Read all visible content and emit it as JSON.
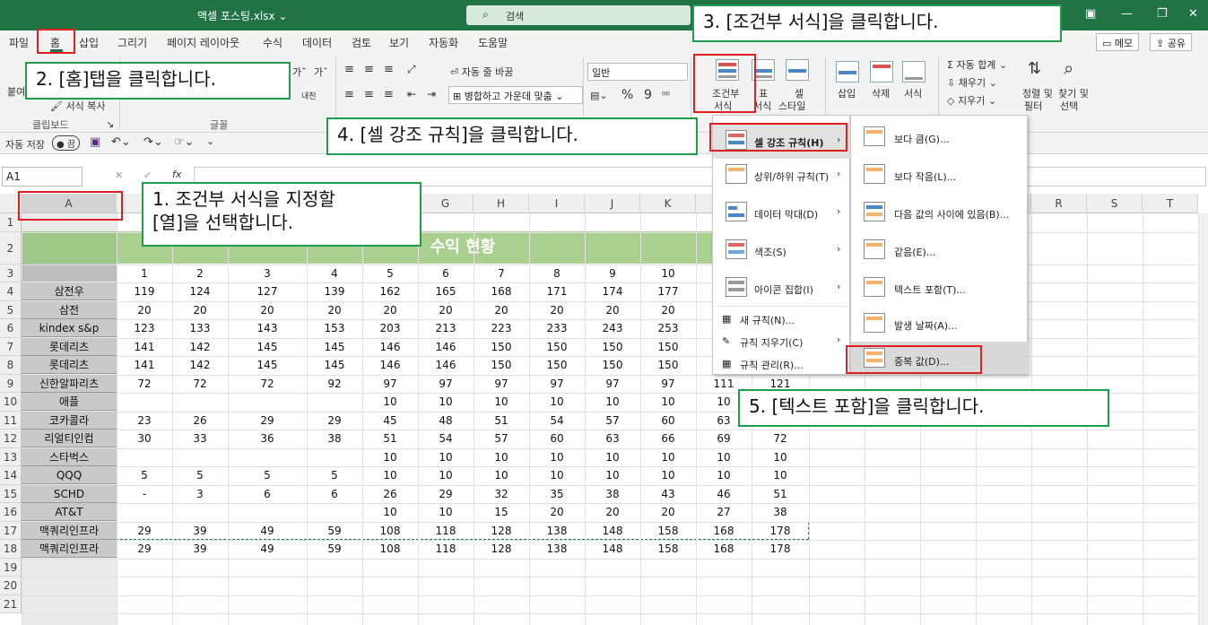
{
  "window": {
    "title": "액셀 포스팅.xlsx ⌄",
    "search_placeholder": "검색"
  },
  "menu_tabs": [
    "파일",
    "홈",
    "삽입",
    "그리기",
    "페이지 레이아웃",
    "수식",
    "데이터",
    "검토",
    "보기",
    "자동화",
    "도움말"
  ],
  "top_right": {
    "memo": "메모",
    "share": "공유"
  },
  "ribbon": {
    "paste": "붙여",
    "format_painter": "서식 복사",
    "clipboard": "클립보드",
    "font_group": "글꼴",
    "font_size_up": "가ˆ",
    "font_size_down": "가ˇ",
    "phonetic": "내천",
    "wrap_text": "자동 줄 바꿈",
    "merge_center": "병합하고 가운데 맞춤",
    "number_format": "일반",
    "percent": "%",
    "comma": "9",
    "cond_format_l1": "조건부",
    "cond_format_l2": "서식",
    "table_l1": "표",
    "table_l2": "서식",
    "cell_style_l1": "셀",
    "cell_style_l2": "스타일",
    "insert": "삽입",
    "delete": "삭제",
    "format": "서식",
    "autosum": "자동 합계",
    "fill": "채우기",
    "clear": "지우기",
    "sort_l1": "정렬 및",
    "sort_l2": "필터",
    "find_l1": "찾기 및",
    "find_l2": "선택"
  },
  "qat": {
    "autosave": "자동 저장",
    "toggle": "끔"
  },
  "formula_bar": {
    "name_box": "A1",
    "fx": "fx"
  },
  "columns": [
    "A",
    "",
    "",
    "",
    "",
    "G",
    "H",
    "I",
    "J",
    "K",
    "",
    "",
    "",
    "",
    "",
    "",
    "R",
    "S",
    "T"
  ],
  "sheet": {
    "title_partial": "수익 현황",
    "header_numbers": [
      "1",
      "2",
      "3",
      "4",
      "5",
      "6",
      "7",
      "8",
      "9",
      "10"
    ],
    "rows": [
      {
        "name": "삼전우",
        "values": [
          "119",
          "124",
          "127",
          "139",
          "162",
          "165",
          "168",
          "171",
          "174",
          "177"
        ]
      },
      {
        "name": "삼전",
        "values": [
          "20",
          "20",
          "20",
          "20",
          "20",
          "20",
          "20",
          "20",
          "20",
          "20"
        ]
      },
      {
        "name": "kindex s&p",
        "values": [
          "123",
          "133",
          "143",
          "153",
          "203",
          "213",
          "223",
          "233",
          "243",
          "253"
        ]
      },
      {
        "name": "롯데리츠",
        "values": [
          "141",
          "142",
          "145",
          "145",
          "146",
          "146",
          "150",
          "150",
          "150",
          "150"
        ]
      },
      {
        "name": "롯데리츠",
        "values": [
          "141",
          "142",
          "145",
          "145",
          "146",
          "146",
          "150",
          "150",
          "150",
          "150"
        ]
      },
      {
        "name": "신한알파리츠",
        "values": [
          "72",
          "72",
          "72",
          "92",
          "97",
          "97",
          "97",
          "97",
          "97",
          "97",
          "111",
          "121"
        ]
      },
      {
        "name": "애플",
        "values": [
          "",
          "",
          "",
          "",
          "10",
          "10",
          "10",
          "10",
          "10",
          "10",
          "10"
        ]
      },
      {
        "name": "코카콜라",
        "values": [
          "23",
          "26",
          "29",
          "29",
          "45",
          "48",
          "51",
          "54",
          "57",
          "60",
          "63"
        ]
      },
      {
        "name": "리얼티인컴",
        "values": [
          "30",
          "33",
          "36",
          "38",
          "51",
          "54",
          "57",
          "60",
          "63",
          "66",
          "69",
          "72"
        ]
      },
      {
        "name": "스타벅스",
        "values": [
          "",
          "",
          "",
          "",
          "10",
          "10",
          "10",
          "10",
          "10",
          "10",
          "10",
          "10"
        ]
      },
      {
        "name": "QQQ",
        "values": [
          "5",
          "5",
          "5",
          "5",
          "10",
          "10",
          "10",
          "10",
          "10",
          "10",
          "10",
          "10"
        ]
      },
      {
        "name": "SCHD",
        "values": [
          "-",
          "3",
          "6",
          "6",
          "26",
          "29",
          "32",
          "35",
          "38",
          "43",
          "46",
          "51"
        ]
      },
      {
        "name": "AT&T",
        "values": [
          "",
          "",
          "",
          "",
          "10",
          "10",
          "15",
          "20",
          "20",
          "20",
          "27",
          "38"
        ]
      },
      {
        "name": "맥쿼리인프라",
        "values": [
          "29",
          "39",
          "49",
          "59",
          "108",
          "118",
          "128",
          "138",
          "148",
          "158",
          "168",
          "178"
        ]
      },
      {
        "name": "맥쿼리인프라",
        "values": [
          "29",
          "39",
          "49",
          "59",
          "108",
          "118",
          "128",
          "138",
          "148",
          "158",
          "168",
          "178"
        ]
      }
    ]
  },
  "cf_menu": [
    {
      "label": "셀 강조 규칙(H)",
      "arrow": "›"
    },
    {
      "label": "상위/하위 규칙(T)",
      "arrow": "›"
    },
    {
      "label": "데이터 막대(D)",
      "arrow": "›"
    },
    {
      "label": "색조(S)",
      "arrow": "›"
    },
    {
      "label": "아이콘 집합(I)",
      "arrow": "›"
    },
    {
      "label": "새 규칙(N)...",
      "arrow": ""
    },
    {
      "label": "규칙 지우기(C)",
      "arrow": "›"
    },
    {
      "label": "규칙 관리(R)...",
      "arrow": ""
    }
  ],
  "highlight_menu": [
    "보다 큼(G)...",
    "보다 작음(L)...",
    "다음 값의 사이에 있음(B)...",
    "같음(E)...",
    "텍스트 포함(T)...",
    "발생 날짜(A)...",
    "중복 값(D)..."
  ],
  "callouts": {
    "c1_line1": "1. 조건부 서식을 지정할",
    "c1_line2": "[열]을 선택합니다.",
    "c2": "2. [홈]탭을 클릭합니다.",
    "c3": "3. [조건부 서식]을 클릭합니다.",
    "c4": "4. [셀 강조 규칙]을 클릭합니다.",
    "c5": "5. [텍스트 포함]을 클릭합니다."
  },
  "colors": {
    "excel_green": "#217346",
    "title_fill": "#a9d08e",
    "callout_border": "#1e9e4c",
    "highlight_red": "#e02020"
  }
}
